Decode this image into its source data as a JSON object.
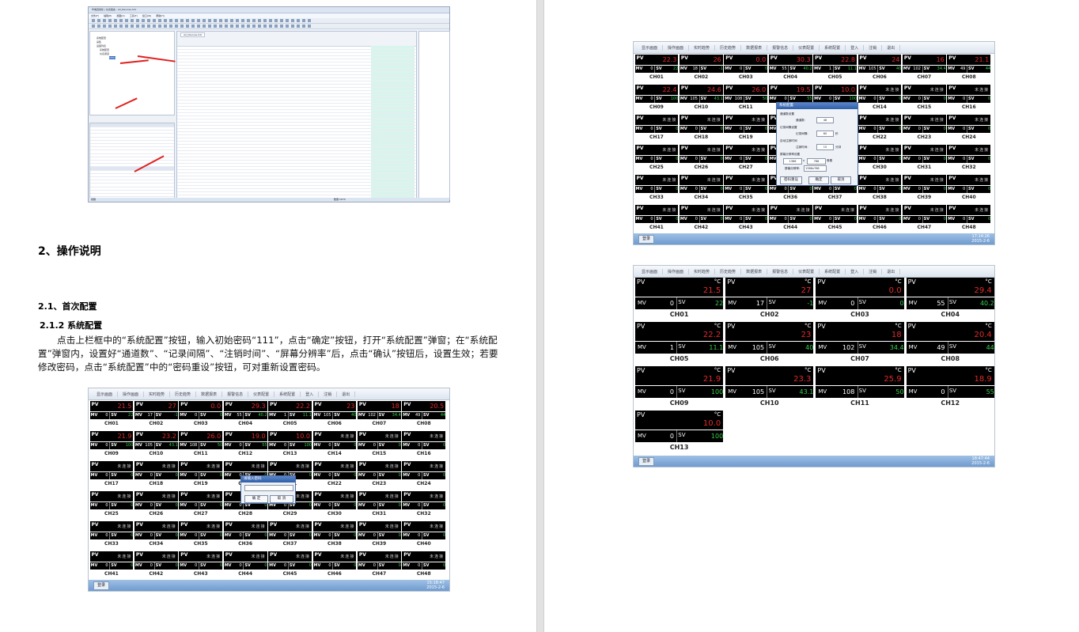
{
  "software": {
    "title": "华电自动化 | 仪表组态 - All_Devices.hdc",
    "menus": [
      "文件(F)",
      "编辑(E)",
      "视图(V)",
      "工具(T)",
      "窗口(W)",
      "帮助(H)"
    ],
    "tab": "All_Devices.hdc",
    "tree": [
      "系统配置",
      "采集",
      "设备列表",
      "系统配置",
      "仪表通道",
      "CH01"
    ],
    "status_left": "就绪",
    "status_right": "数量:1074"
  },
  "doc": {
    "h2": "2、操作说明",
    "h3": "2.1、首次配置",
    "h4": "2.1.2 系统配置",
    "para": "点击上栏框中的“系统配置”按钮，输入初始密码“111”，点击“确定”按钮，打开“系统配置”弹窗；在“系统配置”弹窗内，设置好“通道数”、“记录间隔”、“注销时间”、“屏幕分辨率”后，点击“确认”按钮后，设置生效；若要修改密码，点击“系统配置”中的“密码重设”按钮，可对重新设置密码。"
  },
  "hmi": {
    "nav": [
      "显示画面",
      "操作画面",
      "实时趋势",
      "历史趋势",
      "数据报表",
      "报警信息",
      "仪表配置",
      "系统配置",
      "登入",
      "注销",
      "退出"
    ],
    "bottom_button": "登录",
    "not_connected": "未连接",
    "pv_label": "PV",
    "mv_label": "MV",
    "sv_label": "SV",
    "unit": "°C",
    "clock_a": [
      "15:18:47",
      "2015-2-6"
    ],
    "clock_b": [
      "17:14:26",
      "2015-2-6"
    ],
    "clock_c": [
      "18:47:44",
      "2015-2-6"
    ],
    "channels_small": [
      {
        "pv": "21.5",
        "mv": "0",
        "sv": "22"
      },
      {
        "pv": "27",
        "mv": "17",
        "sv": "-1"
      },
      {
        "pv": "0.0",
        "mv": "0",
        "sv": "0"
      },
      {
        "pv": "29.3",
        "mv": "55",
        "sv": "40.2"
      },
      {
        "pv": "22.2",
        "mv": "1",
        "sv": "11.1"
      },
      {
        "pv": "23",
        "mv": "105",
        "sv": "40"
      },
      {
        "pv": "18",
        "mv": "102",
        "sv": "34.4"
      },
      {
        "pv": "20.5",
        "mv": "49",
        "sv": "44"
      },
      {
        "pv": "21.9",
        "mv": "0",
        "sv": "100"
      },
      {
        "pv": "23.2",
        "mv": "105",
        "sv": "43.1"
      },
      {
        "pv": "26.0",
        "mv": "108",
        "sv": "50"
      },
      {
        "pv": "19.0",
        "mv": "0",
        "sv": "55"
      },
      {
        "pv": "10.0",
        "mv": "0",
        "sv": "100"
      }
    ],
    "channels_small_b": [
      {
        "pv": "22.3",
        "mv": "0",
        "sv": "22"
      },
      {
        "pv": "26",
        "mv": "18",
        "sv": "-1"
      },
      {
        "pv": "0.0",
        "mv": "0",
        "sv": "0"
      },
      {
        "pv": "30.3",
        "mv": "55",
        "sv": "40.2"
      },
      {
        "pv": "22.8",
        "mv": "1",
        "sv": "11.1"
      },
      {
        "pv": "24",
        "mv": "105",
        "sv": "40"
      },
      {
        "pv": "16",
        "mv": "102",
        "sv": "34.4"
      },
      {
        "pv": "21.1",
        "mv": "49",
        "sv": "44"
      },
      {
        "pv": "22.4",
        "mv": "0",
        "sv": "100"
      },
      {
        "pv": "24.6",
        "mv": "105",
        "sv": "43.1"
      },
      {
        "pv": "26.0",
        "mv": "108",
        "sv": "50"
      },
      {
        "pv": "19.5",
        "mv": "0",
        "sv": "55"
      },
      {
        "pv": "10.0",
        "mv": "0",
        "sv": "100"
      }
    ],
    "channels_big": [
      {
        "pv": "21.5",
        "mv": "0",
        "sv": "22"
      },
      {
        "pv": "27",
        "mv": "17",
        "sv": "-1"
      },
      {
        "pv": "0.0",
        "mv": "0",
        "sv": "0"
      },
      {
        "pv": "29.4",
        "mv": "55",
        "sv": "40.2"
      },
      {
        "pv": "22.2",
        "mv": "1",
        "sv": "11.1"
      },
      {
        "pv": "23",
        "mv": "105",
        "sv": "40"
      },
      {
        "pv": "18",
        "mv": "102",
        "sv": "34.4"
      },
      {
        "pv": "20.4",
        "mv": "49",
        "sv": "44"
      },
      {
        "pv": "21.9",
        "mv": "0",
        "sv": "100"
      },
      {
        "pv": "23.3",
        "mv": "105",
        "sv": "43.1"
      },
      {
        "pv": "25.9",
        "mv": "108",
        "sv": "50"
      },
      {
        "pv": "18.9",
        "mv": "0",
        "sv": "55"
      },
      {
        "pv": "10.0",
        "mv": "0",
        "sv": "100"
      }
    ],
    "password_dialog": {
      "title": "请输入密码",
      "ok": "确 定",
      "cancel": "取 消"
    },
    "config_dialog": {
      "title": "系统配置",
      "section1": "通道数设置",
      "channels_label": "通道数:",
      "channels_value": "48",
      "section2": "记录间隔设置",
      "interval_label": "记录间隔:",
      "interval_value": "60",
      "interval_unit": "秒",
      "section3": "自动注销时间",
      "logout_label": "注销时间:",
      "logout_value": "15",
      "logout_unit": "分钟",
      "section4": "屏幕分辨率设置",
      "res_w": "1366",
      "res_h": "768",
      "res_unit": "像素",
      "res_select_label": "屏幕分辨率:",
      "res_select": "1366x768",
      "reset": "密码重设",
      "ok": "确定",
      "cancel": "取消"
    }
  }
}
